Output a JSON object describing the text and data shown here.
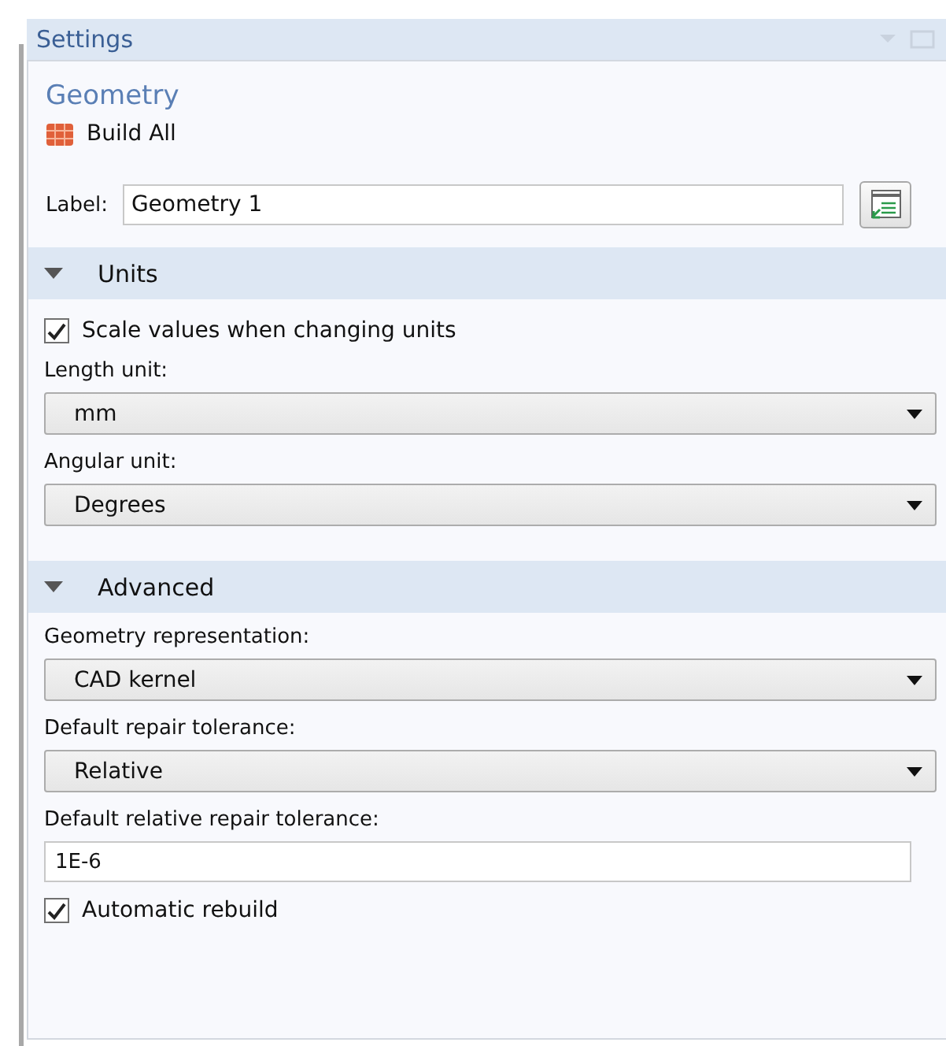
{
  "panel": {
    "title": "Settings"
  },
  "node": {
    "title": "Geometry",
    "action": "Build All"
  },
  "label_field": {
    "label": "Label:",
    "value": "Geometry 1"
  },
  "sections": [
    {
      "title": "Units",
      "expanded": true,
      "items": [
        {
          "kind": "checkbox",
          "label": "Scale values when changing units",
          "checked": true
        },
        {
          "kind": "select",
          "label": "Length unit:",
          "value": "mm"
        },
        {
          "kind": "select",
          "label": "Angular unit:",
          "value": "Degrees"
        }
      ]
    },
    {
      "title": "Advanced",
      "expanded": true,
      "items": [
        {
          "kind": "select",
          "label": "Geometry representation:",
          "value": "CAD kernel"
        },
        {
          "kind": "select",
          "label": "Default repair tolerance:",
          "value": "Relative"
        },
        {
          "kind": "text",
          "label": "Default relative repair tolerance:",
          "value": "1E-6"
        },
        {
          "kind": "checkbox",
          "label": "Automatic rebuild",
          "checked": true
        }
      ]
    }
  ]
}
